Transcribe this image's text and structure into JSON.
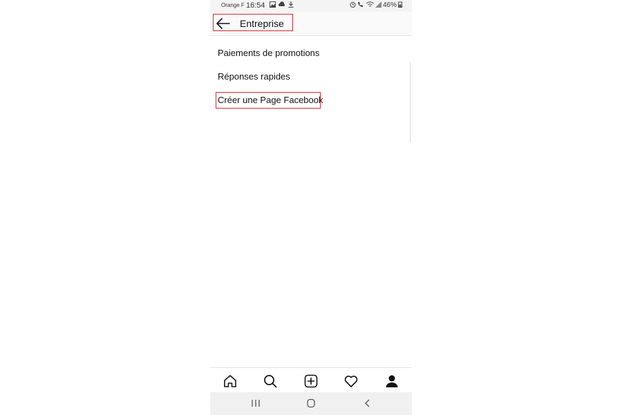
{
  "status_bar": {
    "carrier": "Orange F",
    "time": "16:54",
    "battery": "46%"
  },
  "header": {
    "title": "Entreprise",
    "back_icon": "arrow-left-icon"
  },
  "menu": {
    "items": [
      {
        "label": "Paiements de promotions"
      },
      {
        "label": "Réponses rapides"
      },
      {
        "label": "Créer une Page Facebook"
      }
    ]
  },
  "highlight_color": "#d62b34",
  "tab_bar": {
    "icons": [
      "home-icon",
      "search-icon",
      "add-post-icon",
      "heart-icon",
      "profile-icon"
    ]
  },
  "system_nav": {
    "icons": [
      "recents-icon",
      "home-circle-icon",
      "back-chevron-icon"
    ]
  }
}
